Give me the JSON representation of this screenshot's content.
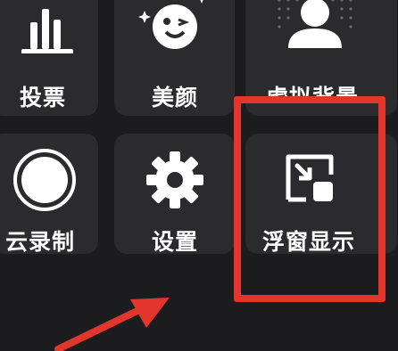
{
  "menu": {
    "items": [
      {
        "label": "投票",
        "icon": "poll-bars-icon"
      },
      {
        "label": "美颜",
        "icon": "beauty-face-sparkle-icon"
      },
      {
        "label": "虚拟背景",
        "icon": "virtual-background-person-icon"
      },
      {
        "label": "云录制",
        "icon": "cloud-record-circle-icon"
      },
      {
        "label": "设置",
        "icon": "settings-gear-icon"
      },
      {
        "label": "浮窗显示",
        "icon": "floating-window-icon"
      }
    ]
  },
  "colors": {
    "background": "#1c1c1e",
    "tile": "#2b2b2e",
    "text": "#ffffff",
    "annotation_red": "#e2362d"
  }
}
